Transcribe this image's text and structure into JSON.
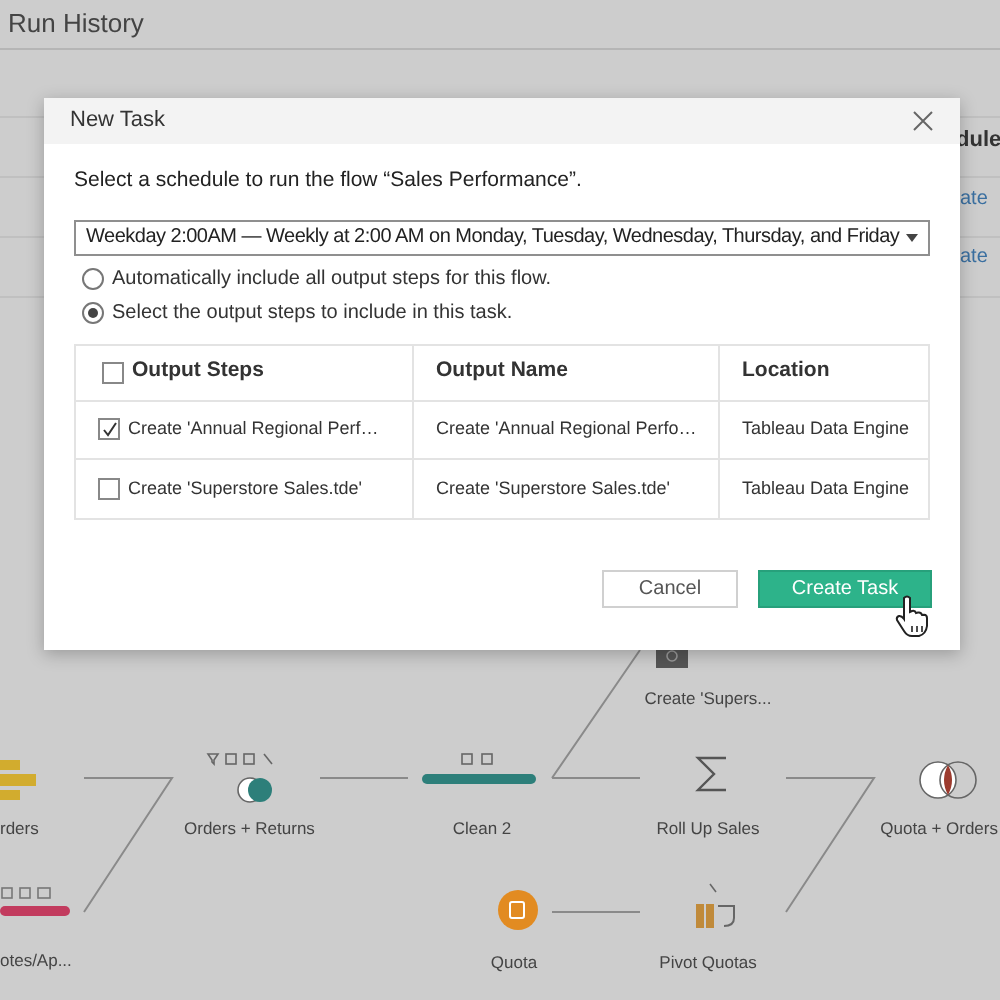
{
  "page": {
    "title": "Run History"
  },
  "background_panel": {
    "column_header": "dule",
    "links": [
      "ate",
      "ate"
    ]
  },
  "dialog": {
    "title": "New Task",
    "prompt": "Select a schedule to run the flow “Sales Performance”.",
    "schedule": {
      "value": "Weekday 2:00AM — Weekly at 2:00 AM on Monday, Tuesday, Wednesday, Thursday, and Friday"
    },
    "options": [
      {
        "label": "Automatically include all output steps for this flow.",
        "selected": false
      },
      {
        "label": "Select the output steps to include in this task.",
        "selected": true
      }
    ],
    "table": {
      "columns": [
        "Output Steps",
        "Output Name",
        "Location"
      ],
      "select_all_checked": false,
      "rows": [
        {
          "checked": true,
          "cells": [
            "Create 'Annual Regional Perf…",
            "Create 'Annual Regional Perfo…",
            "Tableau Data Engine"
          ]
        },
        {
          "checked": false,
          "cells": [
            "Create 'Superstore Sales.tde'",
            "Create 'Superstore Sales.tde'",
            "Tableau Data Engine"
          ]
        }
      ]
    },
    "buttons": [
      {
        "label": "Cancel",
        "kind": "secondary"
      },
      {
        "label": "Create Task",
        "kind": "primary"
      }
    ]
  },
  "flow": {
    "nodes": [
      {
        "label": "rders",
        "kind": "input"
      },
      {
        "label": "otes/Ap...",
        "kind": "clean_pink"
      },
      {
        "label": "Orders + Returns",
        "kind": "join"
      },
      {
        "label": "Clean 2",
        "kind": "clean"
      },
      {
        "label": "Create 'Supers...",
        "kind": "output"
      },
      {
        "label": "Roll Up Sales",
        "kind": "aggregate"
      },
      {
        "label": "Quota + Orders",
        "kind": "join_red"
      },
      {
        "label": "Quota",
        "kind": "input_orange"
      },
      {
        "label": "Pivot Quotas",
        "kind": "pivot"
      }
    ]
  }
}
